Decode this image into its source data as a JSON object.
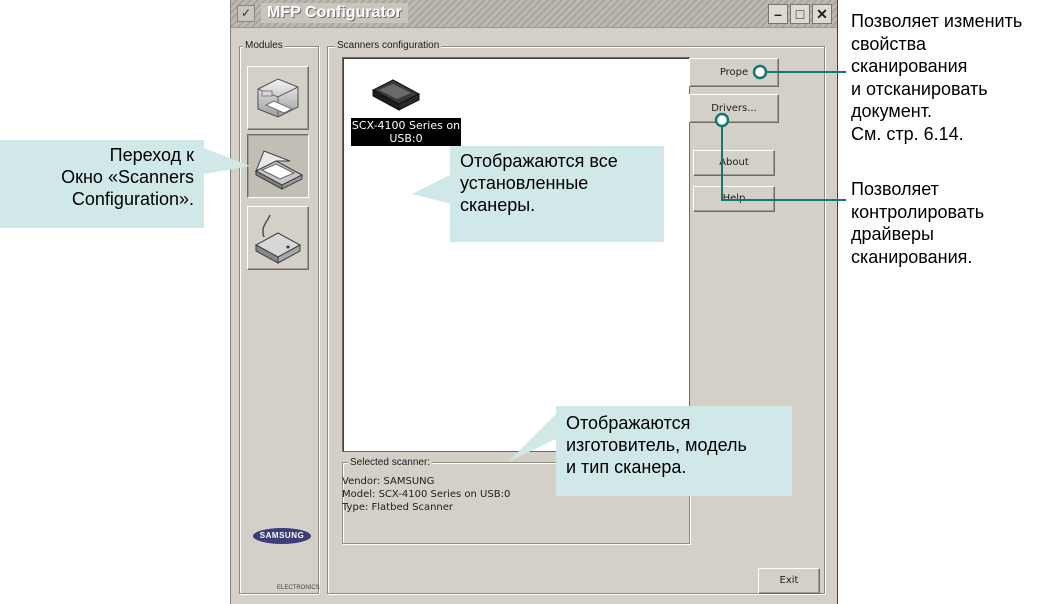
{
  "window": {
    "title": "MFP Configurator",
    "menu_glyph": "✓",
    "minimize_glyph": "–",
    "maximize_glyph": "□",
    "close_glyph": "✕"
  },
  "modules": {
    "label": "Modules",
    "items": [
      {
        "name": "printer",
        "active": false
      },
      {
        "name": "scanner",
        "active": true
      },
      {
        "name": "port",
        "active": false
      }
    ]
  },
  "scanners_config": {
    "label": "Scanners configuration",
    "scanners": [
      {
        "label_line1": "SCX-4100 Series on",
        "label_line2": "USB:0",
        "selected": true
      }
    ]
  },
  "buttons": {
    "properties": "Prope",
    "drivers": "Drivers...",
    "about": "About",
    "help": "Help",
    "exit": "Exit"
  },
  "selected_scanner": {
    "label": "Selected scanner:",
    "vendor": "Vendor: SAMSUNG",
    "model": "Model: SCX-4100 Series on USB:0",
    "type": "Type: Flatbed Scanner"
  },
  "logo": {
    "brand": "SAMSUNG",
    "sub": "ELECTRONICS"
  },
  "callouts": {
    "scanners_list": [
      "Отображаются все",
      "установленные",
      "сканеры."
    ],
    "selected_info": [
      "Отображаются",
      "изготовитель, модель",
      "и тип сканера."
    ],
    "modules": [
      "Переход к",
      "Окно «Scanners",
      "Configuration»."
    ]
  },
  "annotations": {
    "properties": [
      "Позволяет изменить",
      "свойства",
      "сканирования",
      "и отсканировать",
      "документ.",
      "См. стр. 6.14."
    ],
    "drivers": [
      "Позволяет",
      "контролировать",
      "драйверы",
      "сканирования."
    ]
  },
  "colors": {
    "callout_bg": "#d0e9e8",
    "pointer": "#0e7a72",
    "window_bg": "#d4d0c8"
  }
}
